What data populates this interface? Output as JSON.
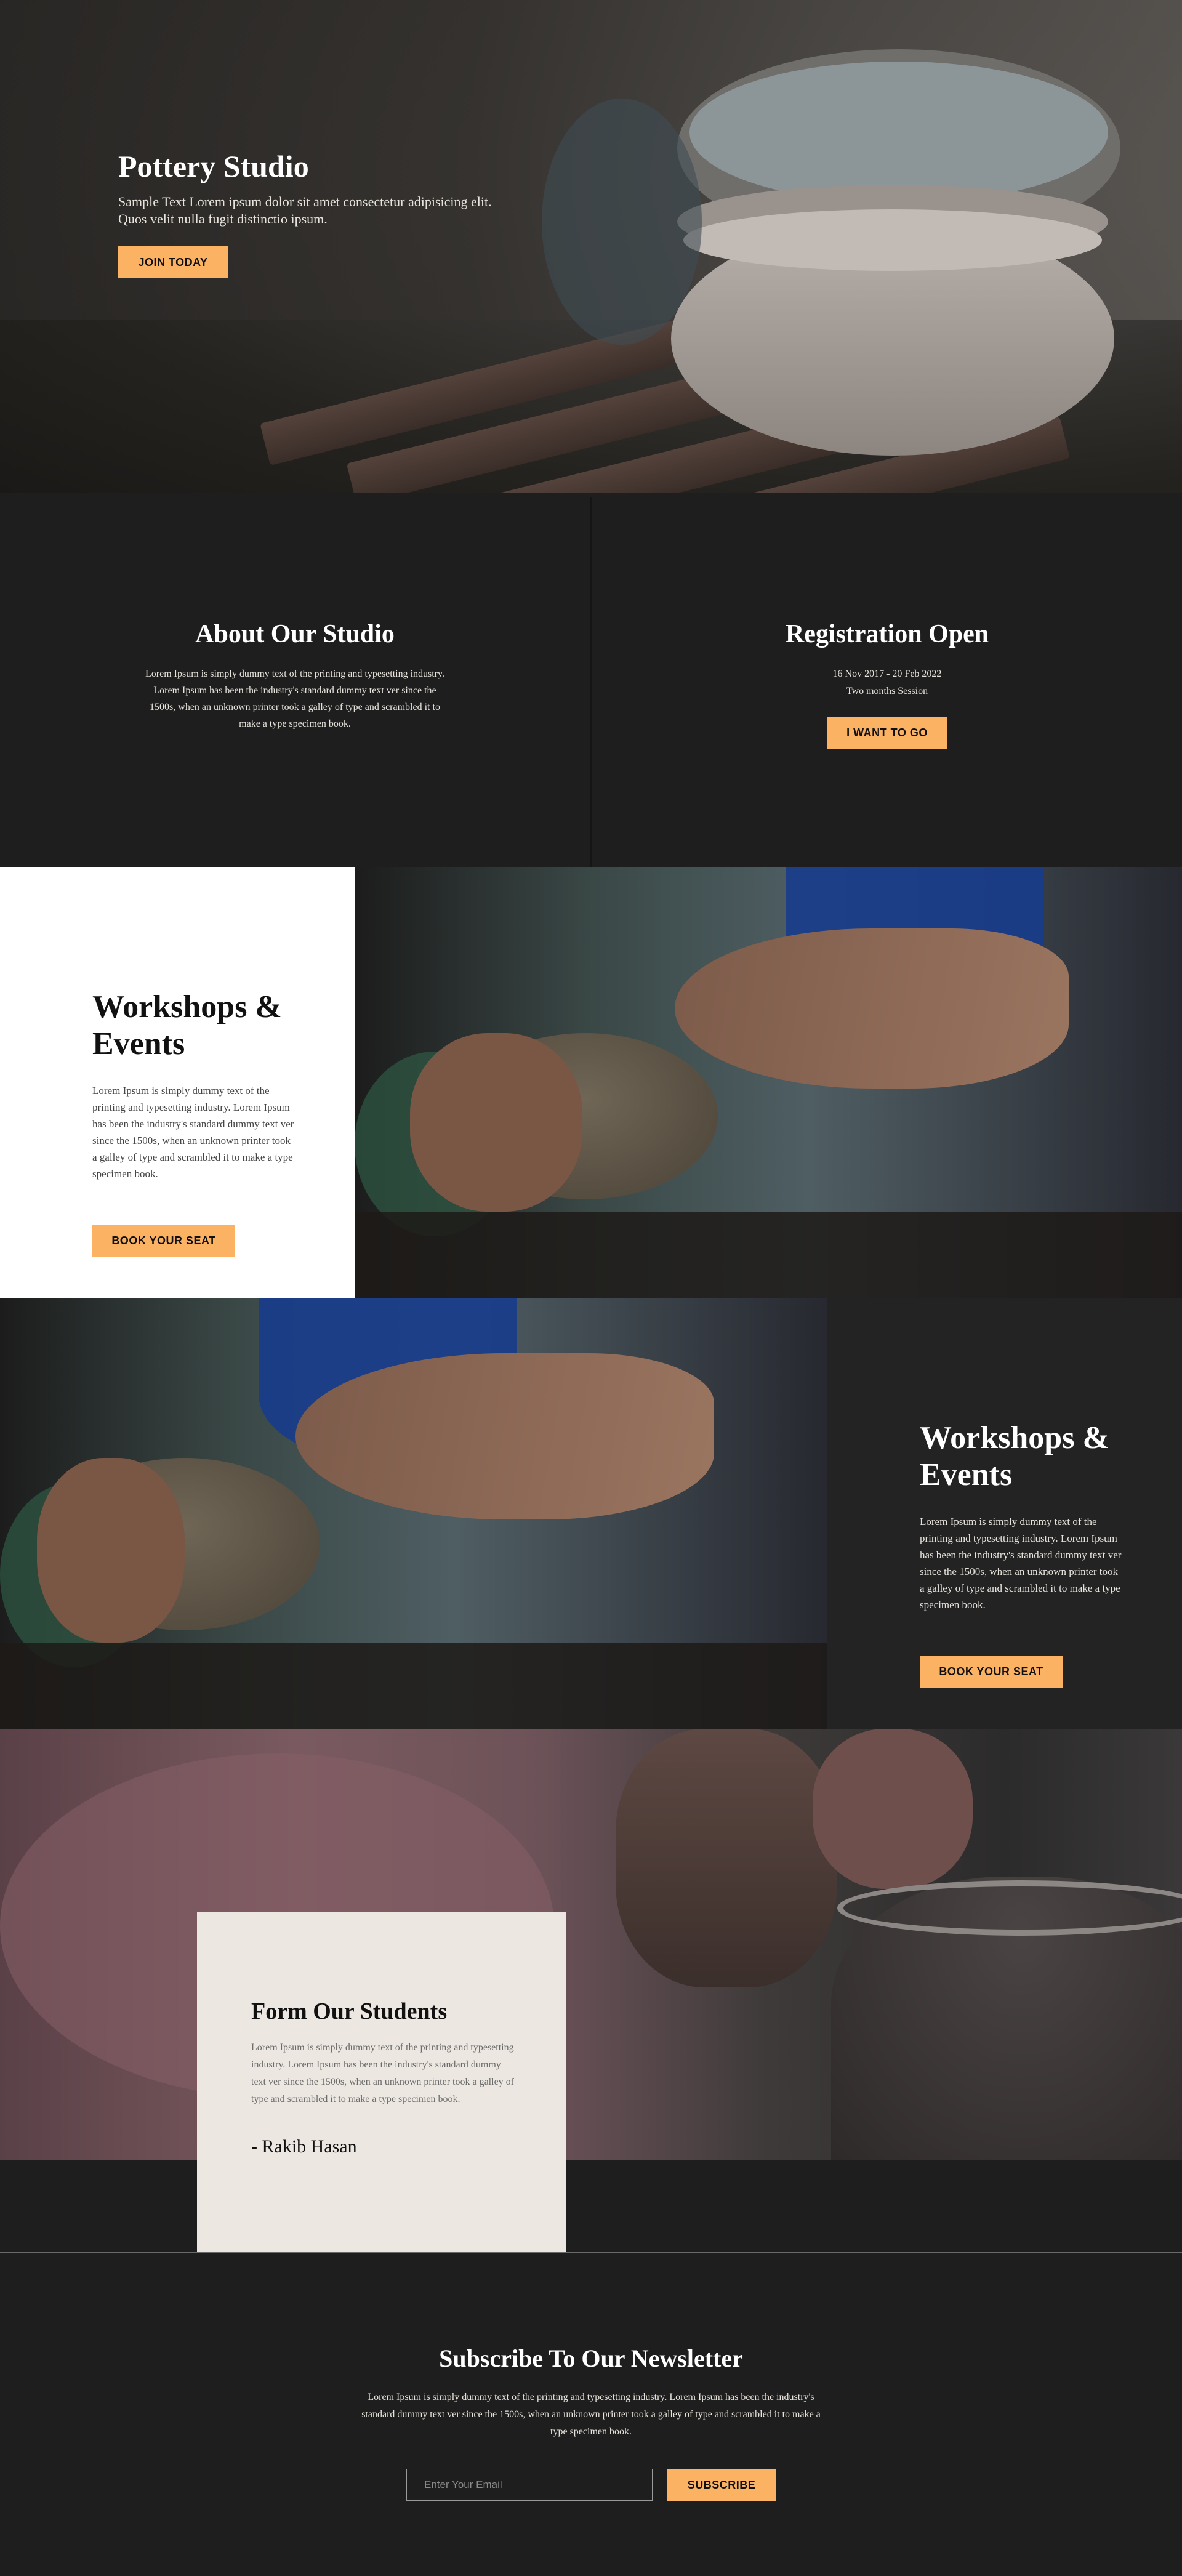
{
  "hero": {
    "title": "Pottery Studio",
    "subtitle": "Sample Text Lorem ipsum dolor sit amet consectetur adipisicing elit. Quos velit nulla fugit distinctio ipsum.",
    "button_label": "JOIN TODAY"
  },
  "about": {
    "title": "About Our Studio",
    "body": "Lorem Ipsum is simply dummy text of the printing and typesetting industry. Lorem Ipsum has been the industry's standard dummy text ver since the 1500s, when an unknown printer took a galley of type and scrambled it to make a type specimen book."
  },
  "registration": {
    "title": "Registration Open",
    "dates": "16 Nov 2017  -  20 Feb 2022",
    "session": "Two months Session",
    "button_label": "I WANT TO GO"
  },
  "workshops_1": {
    "title": "Workshops & Events",
    "body": "Lorem Ipsum is simply dummy text of the printing and typesetting industry. Lorem Ipsum has been the industry's standard dummy text ver since the 1500s, when an unknown printer took a galley of type and scrambled it to make a type specimen book.",
    "button_label": "BOOK YOUR SEAT"
  },
  "workshops_2": {
    "title": "Workshops & Events",
    "body": "Lorem Ipsum is simply dummy text of the printing and typesetting industry. Lorem Ipsum has been the industry's standard dummy text ver since the 1500s, when an unknown printer took a galley of type and scrambled it to make a type specimen book.",
    "button_label": "BOOK YOUR SEAT"
  },
  "testimonial": {
    "title": "Form Our Students",
    "body": "Lorem Ipsum is simply dummy text of the printing and typesetting industry. Lorem Ipsum has been the industry's standard dummy text ver since the 1500s, when an unknown printer took a galley of type and scrambled it to make a type specimen book.",
    "author": "- Rakib Hasan"
  },
  "newsletter": {
    "title": "Subscribe To Our Newsletter",
    "body": "Lorem Ipsum is simply dummy text of the printing and typesetting industry. Lorem Ipsum has been the industry's standard dummy text ver since the 1500s, when an unknown printer took a galley of type and scrambled it to make a type specimen book.",
    "email_placeholder": "Enter Your Email",
    "button_label": "SUBSCRIBE"
  },
  "colors": {
    "accent": "#fbb263",
    "dark_bg": "#1e1e1e",
    "panel_dark": "#232323",
    "card_light": "#ede7e1"
  }
}
